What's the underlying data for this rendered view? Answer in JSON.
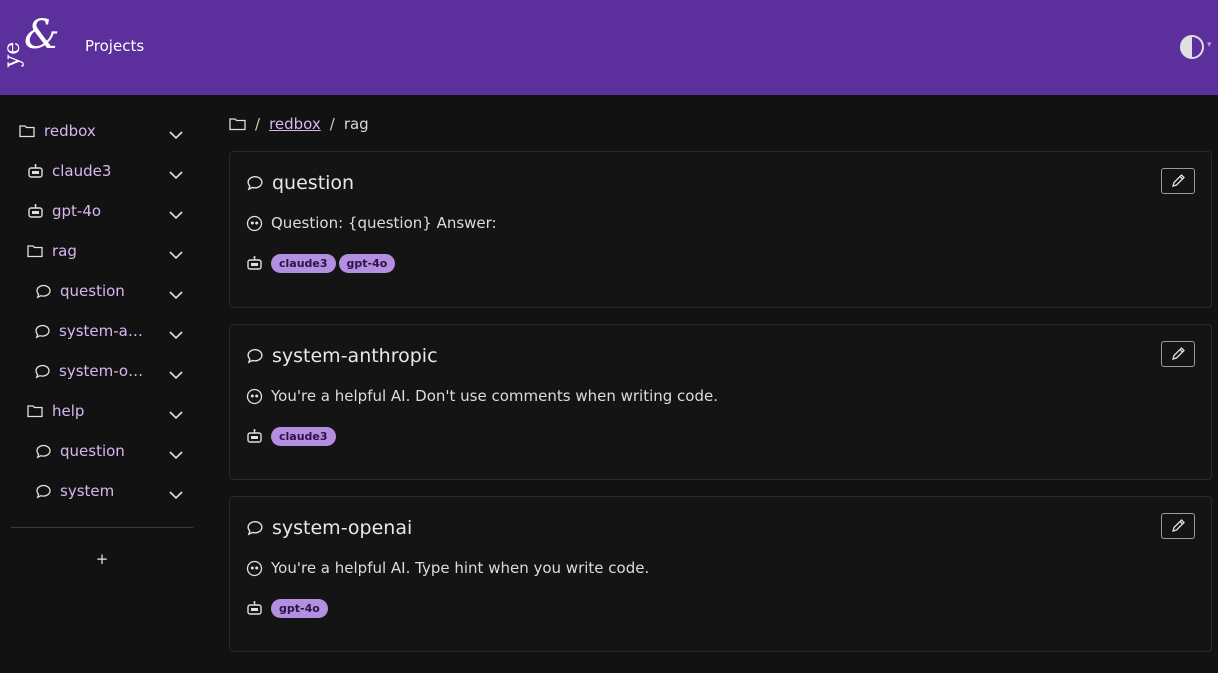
{
  "header": {
    "logo_text": "yes&",
    "nav_title": "Projects",
    "theme_toggle_icon": "half-circle-icon"
  },
  "breadcrumb": {
    "root_icon": "folder-icon",
    "items": [
      "redbox",
      "rag"
    ]
  },
  "sidebar": {
    "items": [
      {
        "label": "redbox",
        "icon": "folder-icon"
      },
      {
        "label": "claude3",
        "icon": "robot-icon"
      },
      {
        "label": "gpt-4o",
        "icon": "robot-icon"
      },
      {
        "label": "rag",
        "icon": "folder-icon"
      },
      {
        "label": "question",
        "icon": "chat-bubble-icon"
      },
      {
        "label": "system-anthropic",
        "icon": "chat-bubble-icon"
      },
      {
        "label": "system-openai",
        "icon": "chat-bubble-icon"
      },
      {
        "label": "help",
        "icon": "folder-icon"
      },
      {
        "label": "question",
        "icon": "chat-bubble-icon"
      },
      {
        "label": "system",
        "icon": "chat-bubble-icon"
      }
    ],
    "add_label": "+"
  },
  "cards": [
    {
      "title": "question",
      "text": "Question: {question} Answer:",
      "tags": [
        "claude3",
        "gpt-4o"
      ]
    },
    {
      "title": "system-anthropic",
      "text": "You're a helpful AI. Don't use comments when writing code.",
      "tags": [
        "claude3"
      ]
    },
    {
      "title": "system-openai",
      "text": "You're a helpful AI. Type hint when you write code.",
      "tags": [
        "gpt-4o"
      ]
    }
  ],
  "colors": {
    "header_bg": "#5b2f9c",
    "accent": "#d6b8f0",
    "tag_bg": "#b48ee0",
    "page_bg": "#121212"
  }
}
